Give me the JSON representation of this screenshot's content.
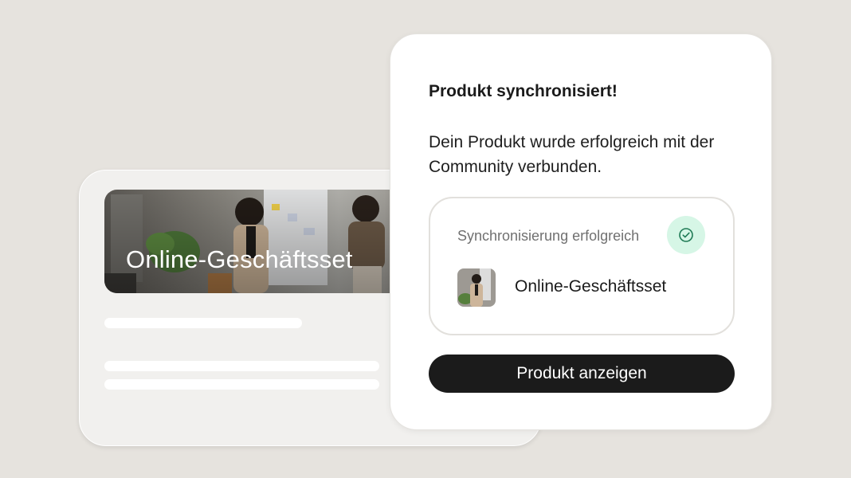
{
  "product_card": {
    "title": "Online-Geschäftsset"
  },
  "dialog": {
    "title": "Produkt synchronisiert!",
    "body": "Dein Produkt wurde erfolgreich mit der Community verbunden.",
    "sync": {
      "status_label": "Synchronisierung erfolgreich",
      "status_icon": "check-circle-icon",
      "product_name": "Online-Geschäftsset"
    },
    "cta_label": "Produkt anzeigen"
  },
  "colors": {
    "background": "#e6e3de",
    "success_badge": "#d6f6e6",
    "success_icon": "#1f7a55",
    "primary_button": "#1b1b1b"
  }
}
